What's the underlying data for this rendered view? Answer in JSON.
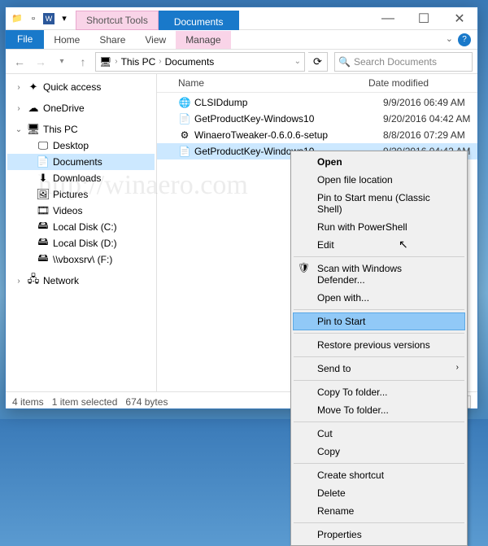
{
  "titlebar": {
    "shortcut_tools_label": "Shortcut Tools",
    "title": "Documents"
  },
  "ribbon": {
    "file": "File",
    "tabs": [
      "Home",
      "Share",
      "View"
    ],
    "manage": "Manage"
  },
  "address": {
    "root": "This PC",
    "folder": "Documents"
  },
  "search": {
    "placeholder": "Search Documents"
  },
  "sidebar": {
    "quick_access": "Quick access",
    "onedrive": "OneDrive",
    "this_pc": "This PC",
    "desktop": "Desktop",
    "documents": "Documents",
    "downloads": "Downloads",
    "pictures": "Pictures",
    "videos": "Videos",
    "local_c": "Local Disk (C:)",
    "local_d": "Local Disk (D:)",
    "vboxsrv": "\\\\vboxsrv\\ (F:)",
    "network": "Network"
  },
  "columns": {
    "name": "Name",
    "date": "Date modified"
  },
  "files": [
    {
      "name": "CLSIDdump",
      "date": "9/9/2016 06:49 AM",
      "icon": "chrome"
    },
    {
      "name": "GetProductKey-Windows10",
      "date": "9/20/2016 04:42 AM",
      "icon": "ps"
    },
    {
      "name": "WinaeroTweaker-0.6.0.6-setup",
      "date": "8/8/2016 07:29 AM",
      "icon": "app"
    },
    {
      "name": "GetProductKey-Windows10",
      "date": "9/20/2016 04:42 AM",
      "icon": "ps",
      "selected": true
    }
  ],
  "status": {
    "count": "4 items",
    "selection": "1 item selected",
    "size": "674 bytes"
  },
  "context_menu": {
    "open": "Open",
    "open_loc": "Open file location",
    "pin_classic": "Pin to Start menu (Classic Shell)",
    "run_ps": "Run with PowerShell",
    "edit": "Edit",
    "scan_defender": "Scan with Windows Defender...",
    "open_with": "Open with...",
    "pin_start": "Pin to Start",
    "restore": "Restore previous versions",
    "send_to": "Send to",
    "copy_folder": "Copy To folder...",
    "move_folder": "Move To folder...",
    "cut": "Cut",
    "copy": "Copy",
    "create_shortcut": "Create shortcut",
    "delete": "Delete",
    "rename": "Rename",
    "properties": "Properties"
  },
  "watermark": "http://winaero.com"
}
